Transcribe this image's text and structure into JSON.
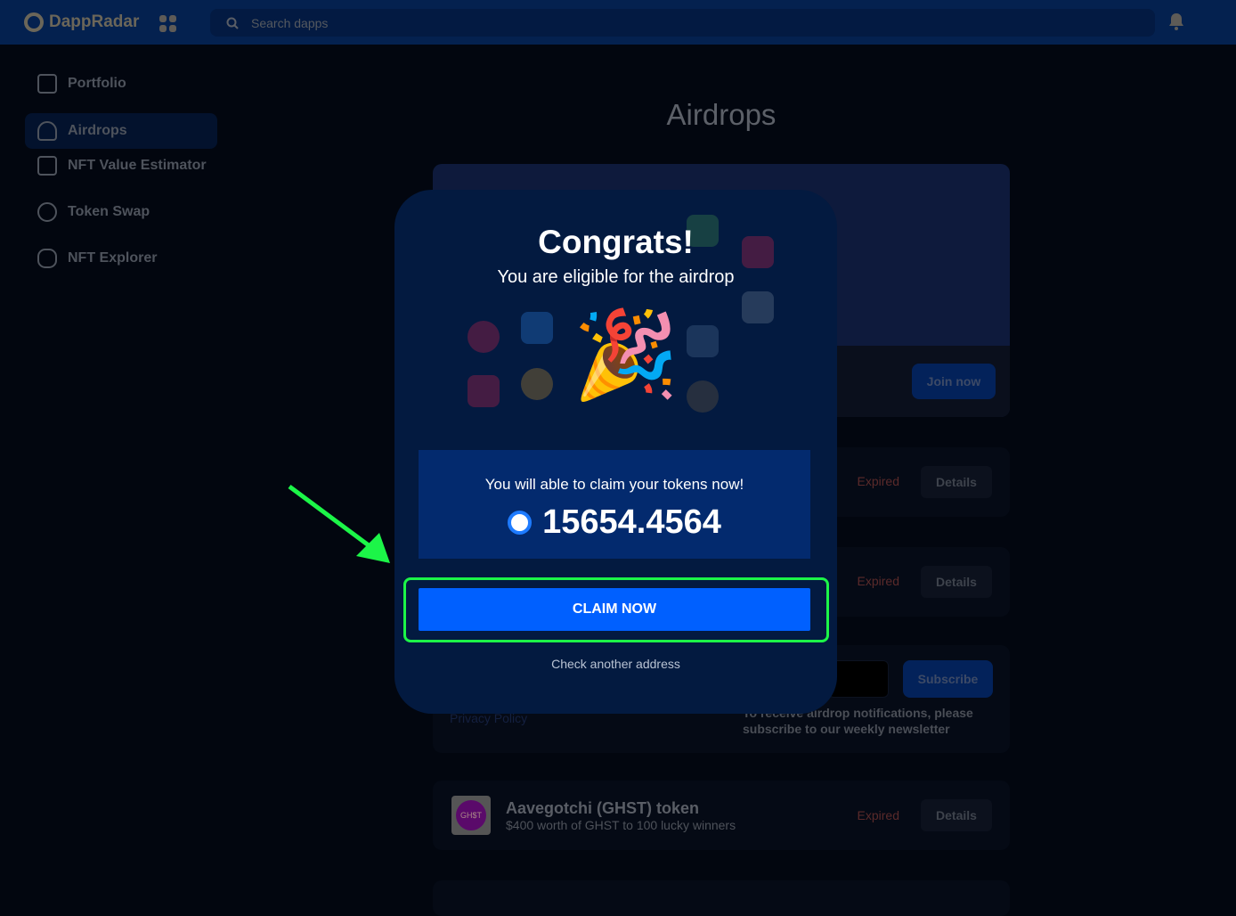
{
  "header": {
    "brand": "DappRadar",
    "search_placeholder": "Search dapps"
  },
  "sidebar": {
    "items": [
      {
        "label": "Portfolio",
        "icon": "briefcase-icon"
      },
      {
        "label": "Airdrops",
        "icon": "parachute-icon",
        "active": true
      },
      {
        "label": "NFT Value Estimator",
        "icon": "chart-icon"
      },
      {
        "label": "Token Swap",
        "icon": "swap-icon"
      },
      {
        "label": "NFT Explorer",
        "icon": "hexagon-star-icon"
      }
    ]
  },
  "main": {
    "title": "Airdrops",
    "banner": {
      "join_label": "Join now"
    },
    "airdrops": [
      {
        "status": "Expired",
        "details_label": "Details"
      },
      {
        "status": "Expired",
        "details_label": "Details"
      },
      {
        "name": "Aavegotchi (GHST) token",
        "description": "$400 worth of GHST to 100 lucky winners",
        "logo_text": "GH$T",
        "status": "Expired",
        "details_label": "Details"
      }
    ],
    "newsletter": {
      "subscribe_label": "Subscribe",
      "text": "To receive airdrop notifications, please subscribe to our weekly newsletter",
      "privacy": "Privacy Policy"
    }
  },
  "modal": {
    "title": "Congrats!",
    "subtitle": "You are eligible for the airdrop",
    "claim_text": "You will able to claim your tokens  now!",
    "amount": "15654.4564",
    "claim_label": "CLAIM NOW",
    "check_another": "Check another address",
    "emoji": "🎉"
  },
  "colors": {
    "accent": "#0060ff",
    "highlight": "#1cf548",
    "modal_bg": "#031a40"
  }
}
